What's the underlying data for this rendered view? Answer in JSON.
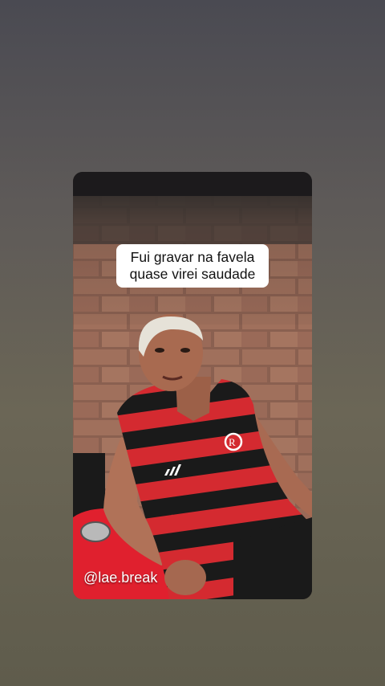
{
  "story": {
    "caption_line1": "Fui gravar na favela",
    "caption_line2": "quase virei saudade",
    "watermark": "@lae.break"
  },
  "colors": {
    "brick": "#9c6a55",
    "jersey_red": "#d42a30",
    "jersey_black": "#1a1a1a",
    "motorbike_red": "#e0202e"
  }
}
